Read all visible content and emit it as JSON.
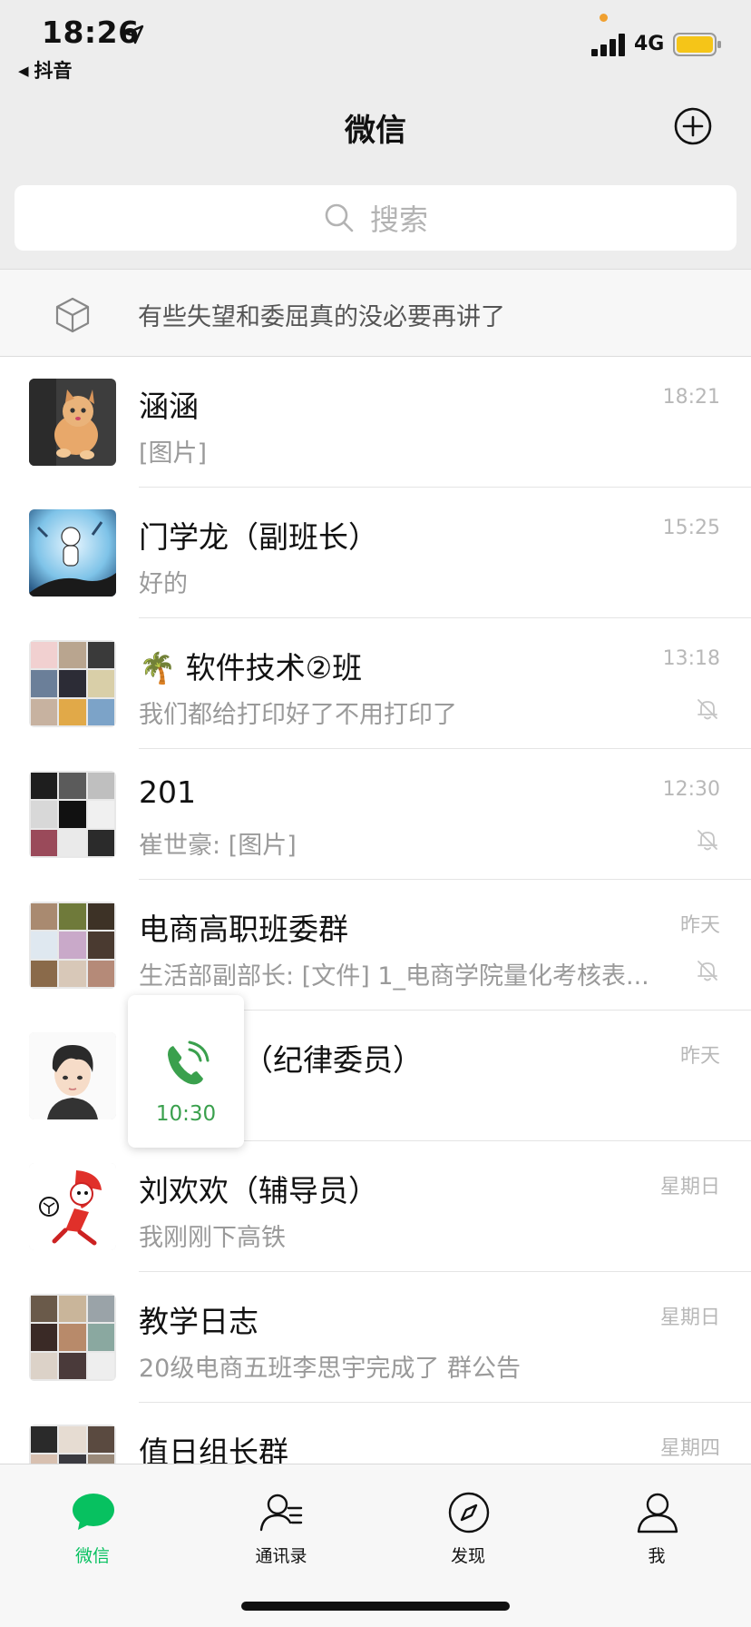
{
  "status_bar": {
    "time": "18:26",
    "back_app": "抖音",
    "network": "4G"
  },
  "nav": {
    "title": "微信"
  },
  "search": {
    "placeholder": "搜索"
  },
  "mini_program": {
    "text": "有些失望和委屈真的没必要再讲了"
  },
  "chats": [
    {
      "name": "涵涵",
      "message": "[图片]",
      "time": "18:21",
      "muted": false
    },
    {
      "name": "门学龙（副班长）",
      "message": "好的",
      "time": "15:25",
      "muted": false
    },
    {
      "name": "🌴 软件技术②班",
      "message": "我们都给打印好了不用打印了",
      "time": "13:18",
      "muted": true
    },
    {
      "name": "201",
      "message": "崔世豪: [图片]",
      "time": "12:30",
      "muted": true
    },
    {
      "name": "电商高职班委群",
      "message": "生活部副部长: [文件] 1_电商学院量化考核表...",
      "time": "昨天",
      "muted": true
    },
    {
      "name": "（纪律委员）",
      "message": "",
      "time": "昨天",
      "muted": false
    },
    {
      "name": "刘欢欢（辅导员）",
      "message": "我刚刚下高铁",
      "time": "星期日",
      "muted": false
    },
    {
      "name": "教学日志",
      "message": "20级电商五班李思宇完成了 群公告",
      "time": "星期日",
      "muted": false
    },
    {
      "name": "值日组长群",
      "message": "",
      "time": "星期四",
      "muted": false
    }
  ],
  "call_float": {
    "duration": "10:30"
  },
  "tabs": [
    {
      "label": "微信",
      "active": true
    },
    {
      "label": "通讯录",
      "active": false
    },
    {
      "label": "发现",
      "active": false
    },
    {
      "label": "我",
      "active": false
    }
  ],
  "colors": {
    "accent_green": "#07c160",
    "call_green": "#3aa04d"
  }
}
